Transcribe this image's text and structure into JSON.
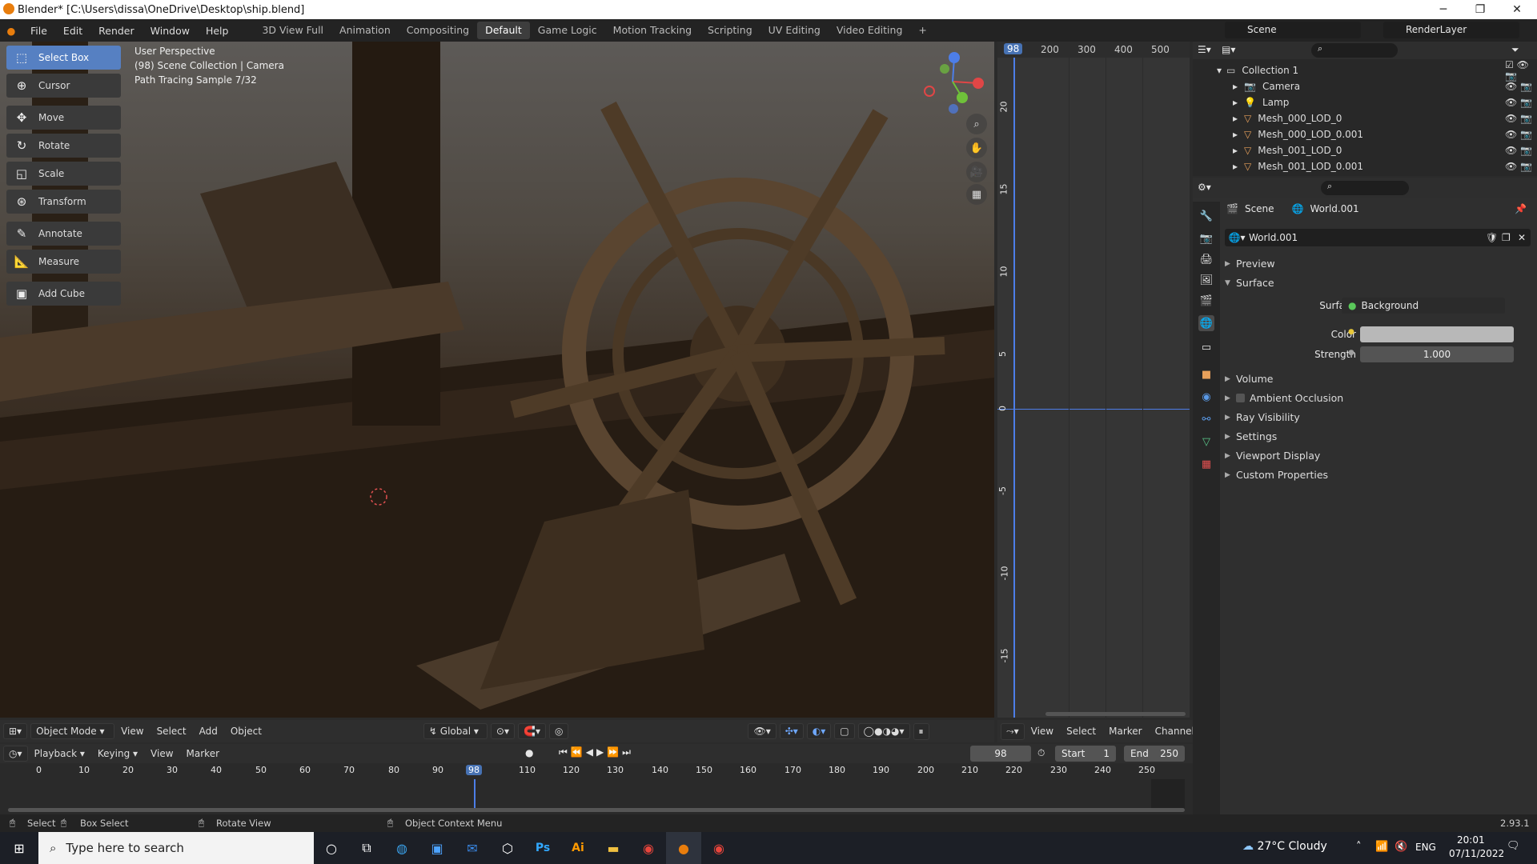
{
  "window": {
    "title": "Blender* [C:\\Users\\dissa\\OneDrive\\Desktop\\ship.blend]"
  },
  "menu": [
    "File",
    "Edit",
    "Render",
    "Window",
    "Help"
  ],
  "workspaces": [
    "3D View Full",
    "Animation",
    "Compositing",
    "Default",
    "Game Logic",
    "Motion Tracking",
    "Scripting",
    "UV Editing",
    "Video Editing"
  ],
  "active_workspace": "Default",
  "scene": {
    "name": "Scene",
    "render_layer": "RenderLayer"
  },
  "tools": [
    {
      "label": "Select Box",
      "icon": "select-box-icon",
      "active": true
    },
    {
      "label": "Cursor",
      "icon": "cursor-icon"
    },
    {
      "label": "Move",
      "icon": "move-icon"
    },
    {
      "label": "Rotate",
      "icon": "rotate-icon"
    },
    {
      "label": "Scale",
      "icon": "scale-icon"
    },
    {
      "label": "Transform",
      "icon": "transform-icon"
    },
    {
      "label": "Annotate",
      "icon": "annotate-icon"
    },
    {
      "label": "Measure",
      "icon": "measure-icon"
    },
    {
      "label": "Add Cube",
      "icon": "add-cube-icon"
    }
  ],
  "viewport": {
    "line1": "User Perspective",
    "line2": "(98) Scene Collection | Camera",
    "line3": "Path Tracing Sample 7/32"
  },
  "viewport_header": {
    "mode": "Object Mode",
    "menus": [
      "View",
      "Select",
      "Add",
      "Object"
    ],
    "orientation": "Global"
  },
  "graph": {
    "ruler": [
      "98",
      "200",
      "300",
      "400",
      "500"
    ],
    "yticks": [
      "20",
      "15",
      "10",
      "5",
      "0",
      "-5",
      "-10",
      "-15"
    ],
    "menus": [
      "View",
      "Select",
      "Marker",
      "Channel"
    ]
  },
  "outliner": {
    "collection": "Collection 1",
    "items": [
      "Camera",
      "Lamp",
      "Mesh_000_LOD_0",
      "Mesh_000_LOD_0.001",
      "Mesh_001_LOD_0",
      "Mesh_001_LOD_0.001"
    ]
  },
  "properties": {
    "breadcrumb_scene": "Scene",
    "breadcrumb_world": "World.001",
    "world_name": "World.001",
    "panels_top": [
      "Preview",
      "Surface"
    ],
    "surface_label": "Surface",
    "surface_value": "Background",
    "color_label": "Color",
    "strength_label": "Strength",
    "strength_value": "1.000",
    "panels_bottom": [
      "Volume",
      "Ambient Occlusion",
      "Ray Visibility",
      "Settings",
      "Viewport Display",
      "Custom Properties"
    ]
  },
  "timeline": {
    "menus": [
      "Playback",
      "Keying",
      "View",
      "Marker"
    ],
    "current_frame": "98",
    "start_label": "Start",
    "start": "1",
    "end_label": "End",
    "end": "250",
    "ticks": [
      "0",
      "10",
      "20",
      "30",
      "40",
      "50",
      "60",
      "70",
      "80",
      "90",
      "98",
      "110",
      "120",
      "130",
      "140",
      "150",
      "160",
      "170",
      "180",
      "190",
      "200",
      "210",
      "220",
      "230",
      "240",
      "250"
    ]
  },
  "status": {
    "select": "Select",
    "box_select": "Box Select",
    "rotate_view": "Rotate View",
    "context_menu": "Object Context Menu",
    "version": "2.93.1"
  },
  "taskbar": {
    "search_placeholder": "Type here to search",
    "weather": "27°C  Cloudy",
    "lang": "ENG",
    "time": "20:01",
    "date": "07/11/2022"
  }
}
